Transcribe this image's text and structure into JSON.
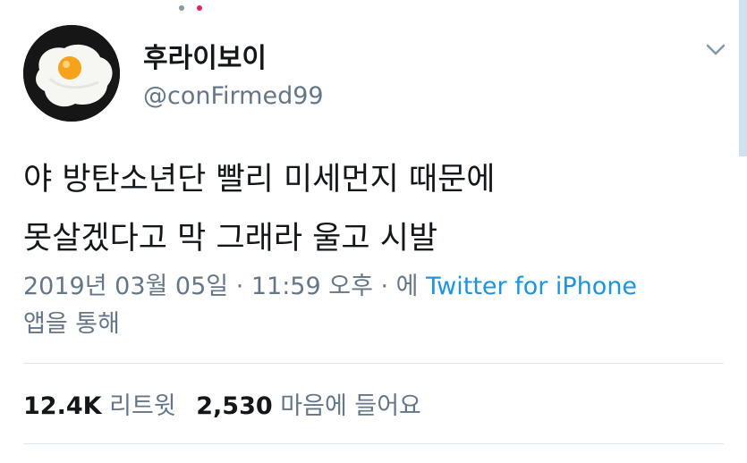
{
  "user": {
    "display_name": "후라이보이",
    "handle": "@conFirmed99"
  },
  "tweet": {
    "lines": [
      "야 방탄소년단 빨리 미세먼지 때문에",
      "못살겠다고 막 그래라 울고 시발"
    ]
  },
  "meta": {
    "timestamp": "2019년 03월 05일 · 11:59 오후 · 에",
    "source": "Twitter for iPhone",
    "suffix": "앱을 통해"
  },
  "stats": {
    "retweets_count": "12.4K",
    "retweets_label": "리트윗",
    "likes_count": "2,530",
    "likes_label": "마음에 들어요"
  },
  "icons": {
    "more": "chevron-down-icon",
    "avatar_image": "fried-egg"
  },
  "colors": {
    "link": "#1b95e0",
    "secondary_text": "#657786",
    "divider": "#e1e8ed"
  }
}
